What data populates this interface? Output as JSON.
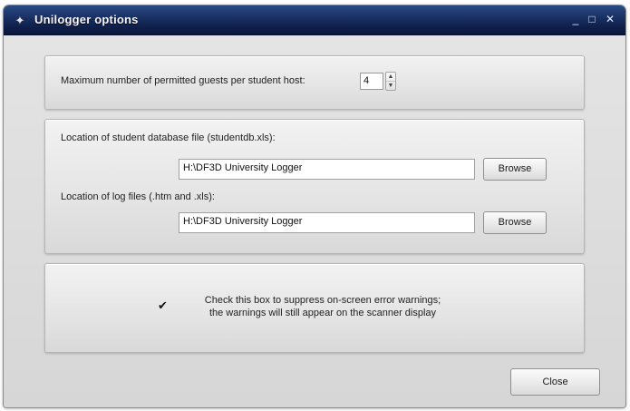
{
  "window": {
    "title": "Unilogger options",
    "app_icon": "app-icon",
    "controls": {
      "minimize": "_",
      "maximize": "□",
      "close": "✕"
    }
  },
  "guests": {
    "label": "Maximum number of permitted guests per student host:",
    "value": "4",
    "spin_up": "▲",
    "spin_down": "▼"
  },
  "locations": {
    "student_db_label": "Location of student database file (studentdb.xls):",
    "student_db_value": "H:\\DF3D University Logger",
    "log_files_label": "Location of log files (.htm and .xls):",
    "log_files_value": "H:\\DF3D University Logger",
    "browse_label": "Browse"
  },
  "warnings": {
    "checked": true,
    "check_glyph": "✔",
    "line1": "Check this box to suppress on-screen error warnings;",
    "line2": "the warnings will still appear on the scanner display"
  },
  "footer": {
    "close_label": "Close"
  }
}
